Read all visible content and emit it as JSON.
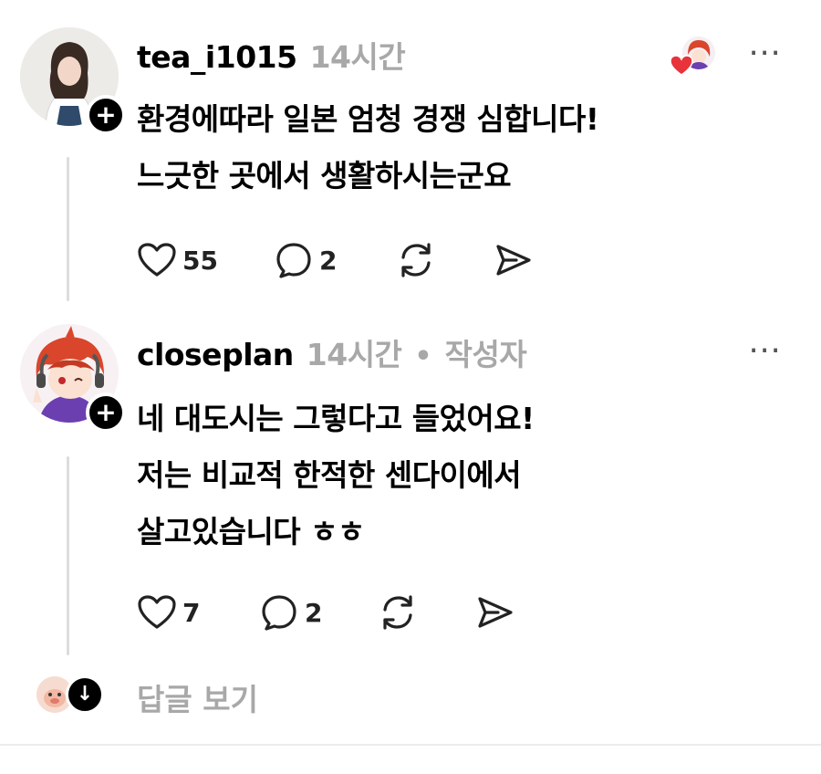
{
  "comments": [
    {
      "username": "tea_i1015",
      "time": "14시간",
      "author_tag": "",
      "text": "환경에따라 일본 엄청 경쟁 심합니다!\n느긋한 곳에서 생활하시는군요",
      "likes": "55",
      "replies": "2",
      "liked_by_author": true,
      "avatar_icon": "profile-photo"
    },
    {
      "username": "closeplan",
      "time": "14시간",
      "author_tag": "작성자",
      "separator": "•",
      "text": "네 대도시는 그렇다고 들었어요!\n저는 비교적 한적한 센다이에서\n살고있습니다 ㅎㅎ",
      "likes": "7",
      "replies": "2",
      "avatar_icon": "anime-character-avatar"
    }
  ],
  "footer": {
    "view_replies_label": "답글 보기"
  },
  "icons": {
    "more": "⋯",
    "follow": "+",
    "expand": "↓"
  },
  "colors": {
    "muted_text": "#a8a8a8",
    "heart_red": "#e8333b",
    "thread_line": "#dcdcdc"
  }
}
